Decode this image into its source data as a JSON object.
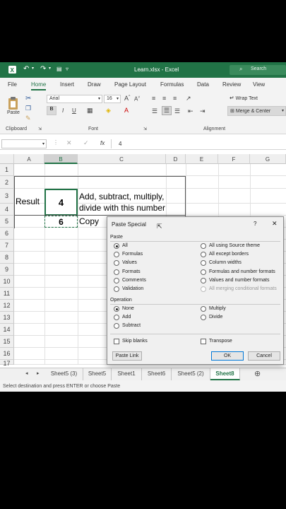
{
  "titlebar": {
    "filename": "Learn.xlsx",
    "separator": "-",
    "app": "Excel",
    "search_placeholder": "Search"
  },
  "menu": [
    "File",
    "Home",
    "Insert",
    "Draw",
    "Page Layout",
    "Formulas",
    "Data",
    "Review",
    "View"
  ],
  "ribbon": {
    "paste_label": "Paste",
    "clipboard_label": "Clipboard",
    "font_name": "Arial",
    "font_size": "16",
    "font_group_label": "Font",
    "bold": "B",
    "italic": "I",
    "underline": "U",
    "wrap_text": "Wrap Text",
    "merge_center": "Merge & Center",
    "alignment_label": "Alignment"
  },
  "formula_bar": {
    "fx": "fx",
    "value": "4"
  },
  "columns": [
    "A",
    "B",
    "C",
    "D",
    "E",
    "F",
    "G"
  ],
  "rows": [
    "1",
    "2",
    "3",
    "4",
    "5",
    "6",
    "7",
    "8",
    "9",
    "10",
    "11",
    "12",
    "13",
    "14",
    "15",
    "16",
    "17"
  ],
  "cells": {
    "a3": "Result",
    "b3": "4",
    "c3_line1": "Add, subtract, multiply,",
    "c3_line2": "divide with this number",
    "b5": "6",
    "c5": "Copy"
  },
  "sheets": [
    "Sheet5 (3)",
    "Sheet5",
    "Sheet1",
    "Sheet6",
    "Sheet5 (2)",
    "Sheet8"
  ],
  "active_sheet": "Sheet8",
  "status": "Select destination and press ENTER or choose Paste",
  "dialog": {
    "title": "Paste Special",
    "help": "?",
    "close": "✕",
    "paste_section": "Paste",
    "paste_left": [
      "All",
      "Formulas",
      "Values",
      "Formats",
      "Comments",
      "Validation"
    ],
    "paste_right": [
      "All using Source theme",
      "All except borders",
      "Column widths",
      "Formulas and number formats",
      "Values and number formats",
      "All merging conditional formats"
    ],
    "operation_section": "Operation",
    "op_left": [
      "None",
      "Add",
      "Subtract"
    ],
    "op_right": [
      "Multiply",
      "Divide"
    ],
    "skip_blanks": "Skip blanks",
    "transpose": "Transpose",
    "paste_link": "Paste Link",
    "ok": "OK",
    "cancel": "Cancel"
  }
}
